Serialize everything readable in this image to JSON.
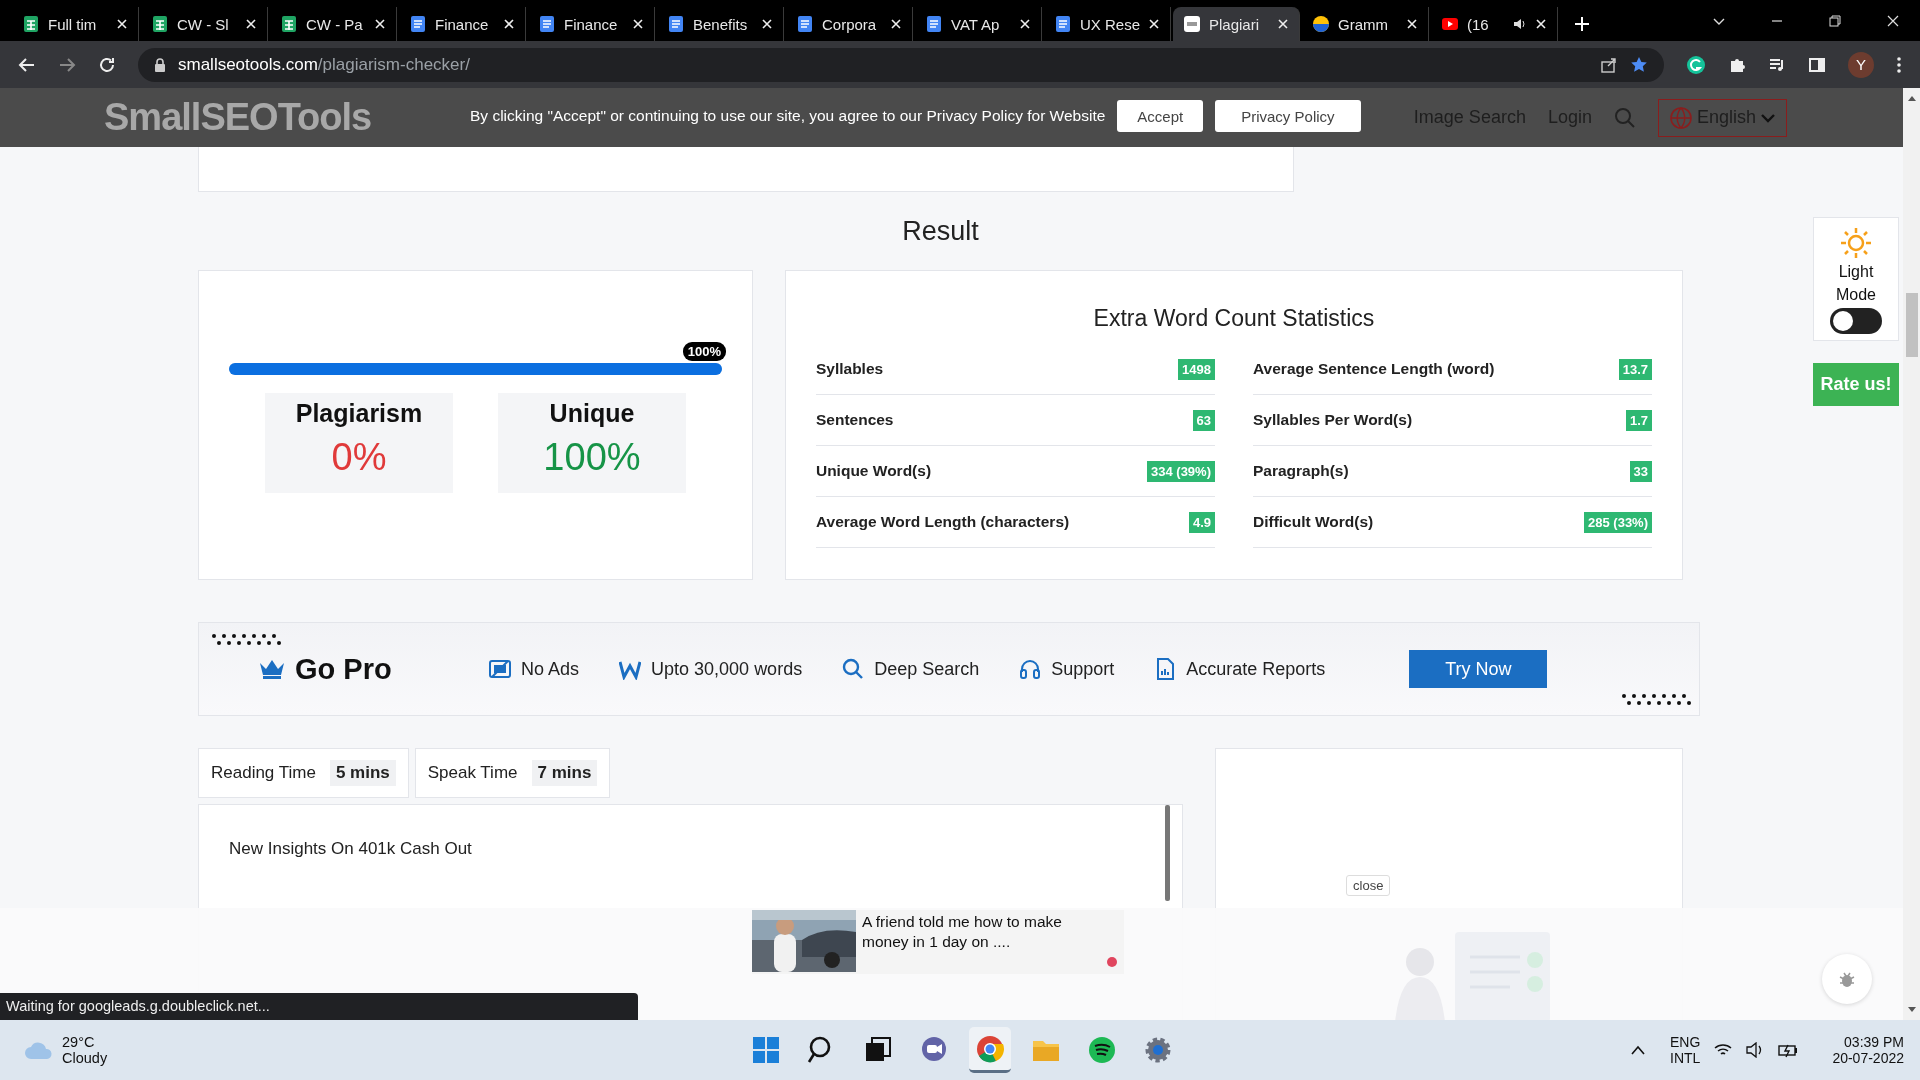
{
  "browser": {
    "tabs": [
      {
        "title": "Full tim",
        "kind": "sheets",
        "selected": false
      },
      {
        "title": "CW - Sl",
        "kind": "sheets",
        "selected": false
      },
      {
        "title": "CW - Pa",
        "kind": "sheets",
        "selected": false
      },
      {
        "title": "Finance",
        "kind": "docs",
        "selected": false
      },
      {
        "title": "Finance",
        "kind": "docs",
        "selected": false
      },
      {
        "title": "Benefits",
        "kind": "docs",
        "selected": false
      },
      {
        "title": "Corpora",
        "kind": "docs",
        "selected": false
      },
      {
        "title": "VAT Ap",
        "kind": "docs",
        "selected": false
      },
      {
        "title": "UX Rese",
        "kind": "docs",
        "selected": false
      },
      {
        "title": "Plagiari",
        "kind": "site",
        "selected": true
      },
      {
        "title": "Gramm",
        "kind": "globe",
        "selected": false
      },
      {
        "title": "(16",
        "kind": "video",
        "selected": false,
        "audio": true
      }
    ],
    "url": {
      "domain": "smallseotools.com",
      "path": "/plagiarism-checker/"
    },
    "profile_initial": "Y"
  },
  "site_header": {
    "logo": "SmallSEOTools",
    "nav": [
      "Image Search",
      "Login"
    ],
    "language": "English"
  },
  "cookie_banner": {
    "text": "By clicking \"Accept\" or continuing to use our site, you agree to our Privacy Policy for Website",
    "buttons": [
      "Accept",
      "Privacy Policy"
    ]
  },
  "result": {
    "title": "Result",
    "progress": {
      "level": 1,
      "label": "100%"
    },
    "scores": [
      {
        "label": "Plagiarism",
        "value": "0%",
        "kind": "bad"
      },
      {
        "label": "Unique",
        "value": "100%",
        "kind": "good"
      }
    ]
  },
  "stats": {
    "title": "Extra Word Count Statistics",
    "columns": [
      [
        {
          "label": "Syllables",
          "value": "1498"
        },
        {
          "label": "Sentences",
          "value": "63"
        },
        {
          "label": "Unique Word(s)",
          "value": "334 (39%)"
        },
        {
          "label": "Average Word Length (characters)",
          "value": "4.9"
        }
      ],
      [
        {
          "label": "Average Sentence Length (word)",
          "value": "13.7"
        },
        {
          "label": "Syllables Per Word(s)",
          "value": "1.7"
        },
        {
          "label": "Paragraph(s)",
          "value": "33"
        },
        {
          "label": "Difficult Word(s)",
          "value": "285 (33%)"
        }
      ]
    ]
  },
  "go_pro": {
    "title": "Go Pro",
    "features": [
      {
        "label": "No Ads",
        "kind": "no-ads"
      },
      {
        "label": "Upto 30,000 words",
        "kind": "word"
      },
      {
        "label": "Deep Search",
        "kind": "search"
      },
      {
        "label": "Support",
        "kind": "headset"
      },
      {
        "label": "Accurate Reports",
        "kind": "report"
      }
    ],
    "button": "Try Now"
  },
  "times": [
    {
      "label": "Reading Time",
      "value": "5 mins"
    },
    {
      "label": "Speak Time",
      "value": "7 mins"
    }
  ],
  "article": {
    "title": "New Insights On 401k Cash Out"
  },
  "side_panel": {
    "mode_label": "Light Mode",
    "dark_mode_on": false,
    "rate_button": "Rate us!"
  },
  "ad": {
    "text": "A friend told me how to make money in 1 day on ....",
    "close": "close"
  },
  "status_text": "Waiting for googleads.g.doubleclick.net...",
  "taskbar": {
    "weather": {
      "temp": "29°C",
      "condition": "Cloudy"
    },
    "apps": [
      {
        "kind": "windows",
        "active": false
      },
      {
        "kind": "search",
        "active": false
      },
      {
        "kind": "taskview",
        "active": false
      },
      {
        "kind": "chat",
        "active": false
      },
      {
        "kind": "chrome",
        "active": true
      },
      {
        "kind": "folder",
        "active": false
      },
      {
        "kind": "music",
        "active": false
      },
      {
        "kind": "gear",
        "active": false
      }
    ],
    "language": [
      "ENG",
      "INTL"
    ],
    "time": "03:39 PM",
    "date": "20-07-2022"
  }
}
